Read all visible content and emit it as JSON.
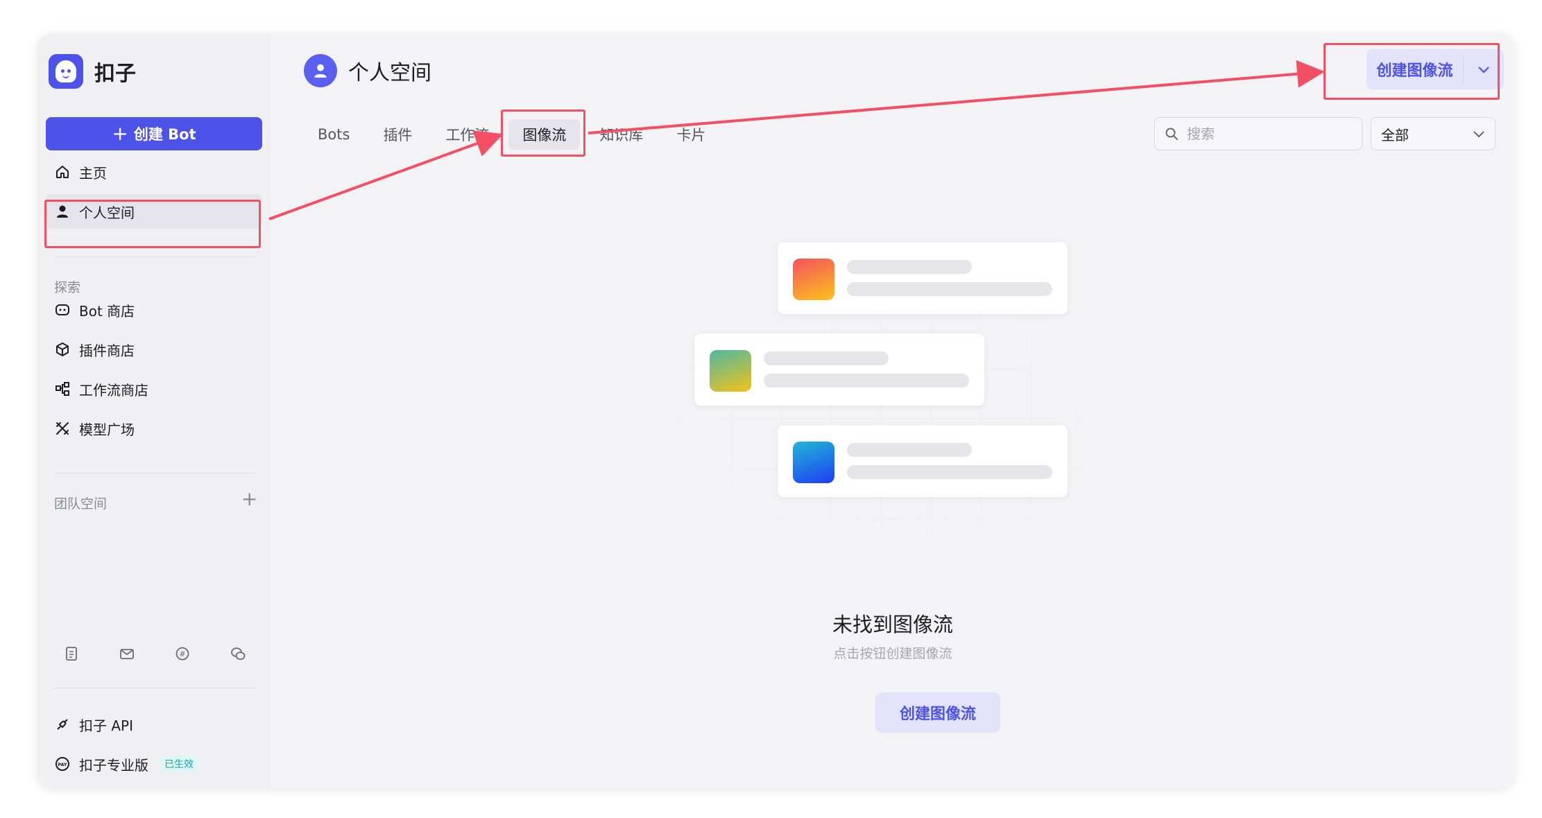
{
  "brand": {
    "name": "扣子"
  },
  "sidebar": {
    "create_label": "创建 Bot",
    "nav": [
      {
        "label": "主页",
        "icon": "home-icon"
      },
      {
        "label": "个人空间",
        "icon": "person-icon",
        "active": true
      }
    ],
    "explore_label": "探索",
    "explore": [
      {
        "label": "Bot 商店",
        "icon": "bot-icon"
      },
      {
        "label": "插件商店",
        "icon": "cube-icon"
      },
      {
        "label": "工作流商店",
        "icon": "workflow-icon"
      },
      {
        "label": "模型广场",
        "icon": "model-icon"
      }
    ],
    "team_label": "团队空间",
    "bottom": [
      {
        "label": "扣子 API",
        "icon": "api-icon"
      },
      {
        "label": "扣子专业版",
        "icon": "pay-icon",
        "badge": "已生效"
      }
    ]
  },
  "header": {
    "space_name": "个人空间",
    "create_label": "创建图像流"
  },
  "tabs": [
    {
      "label": "Bots"
    },
    {
      "label": "插件"
    },
    {
      "label": "工作流"
    },
    {
      "label": "图像流",
      "active": true
    },
    {
      "label": "知识库"
    },
    {
      "label": "卡片"
    }
  ],
  "search": {
    "placeholder": "搜索"
  },
  "filter": {
    "value": "全部"
  },
  "empty": {
    "title": "未找到图像流",
    "subtitle": "点击按钮创建图像流",
    "button_label": "创建图像流"
  },
  "colors": {
    "accent": "#4d53e8",
    "highlight": "#f24e64"
  }
}
